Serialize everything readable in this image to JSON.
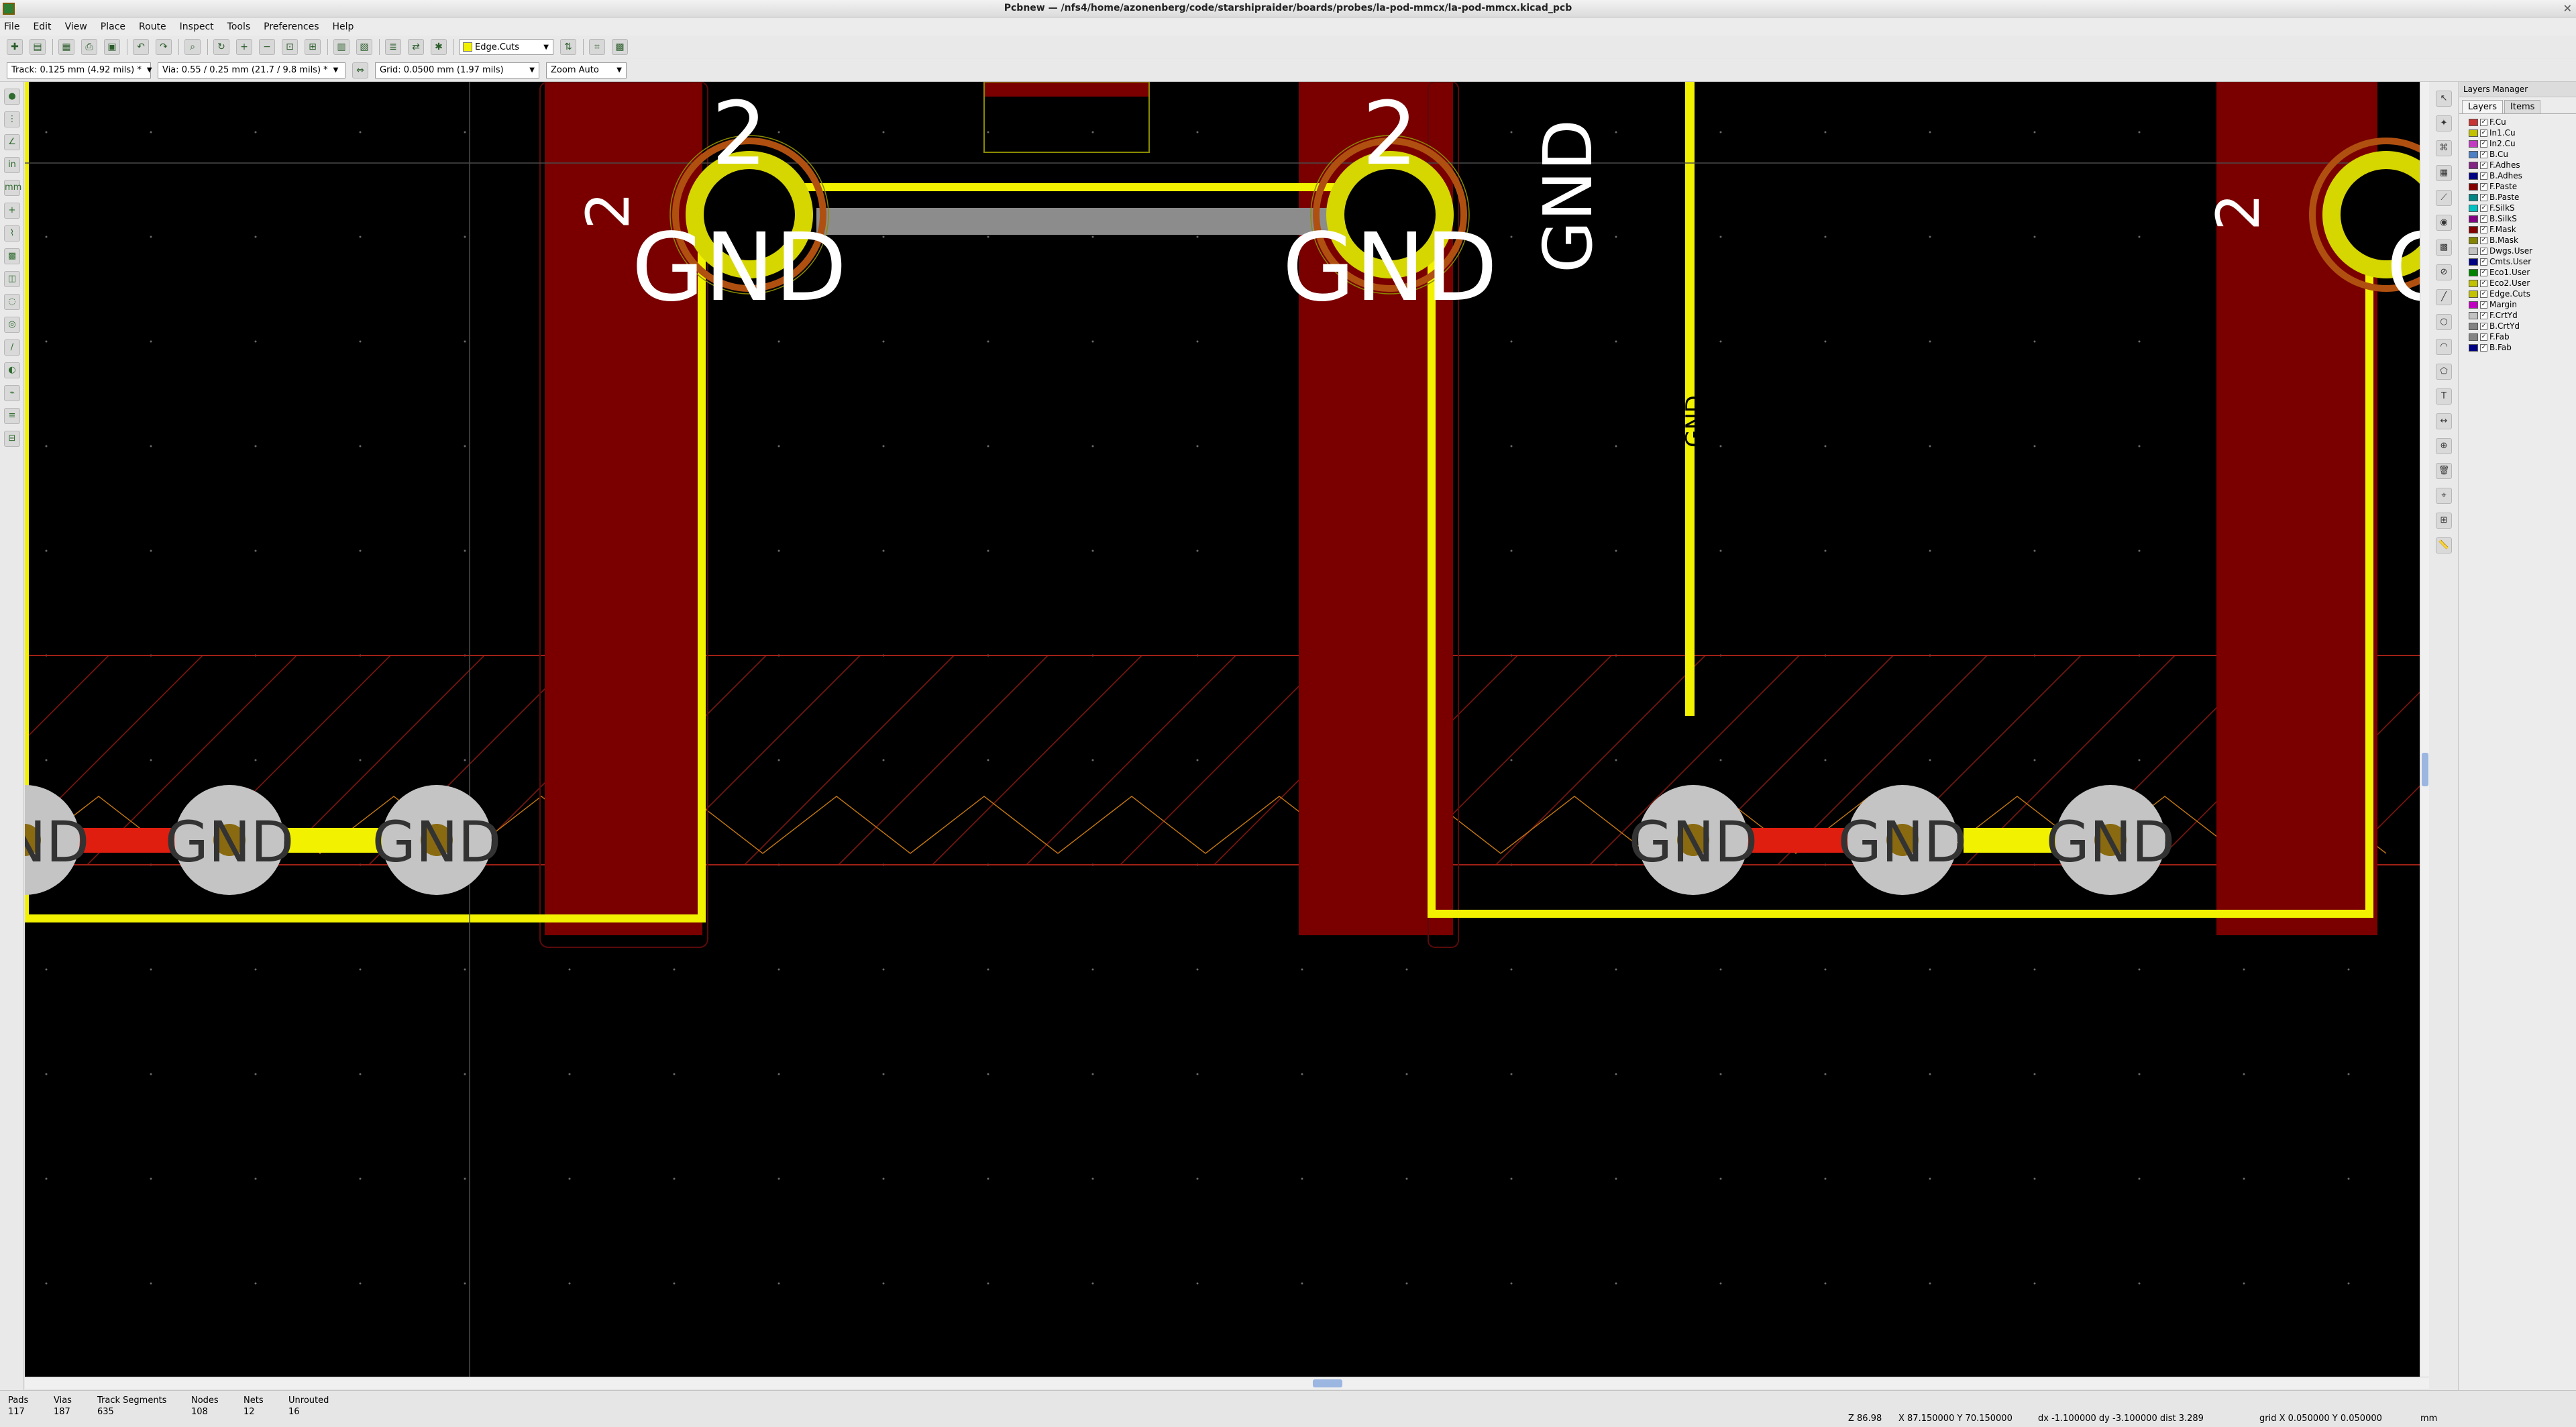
{
  "window": {
    "title": "Pcbnew — /nfs4/home/azonenberg/code/starshipraider/boards/probes/la-pod-mmcx/la-pod-mmcx.kicad_pcb"
  },
  "menu": [
    "File",
    "Edit",
    "View",
    "Place",
    "Route",
    "Inspect",
    "Tools",
    "Preferences",
    "Help"
  ],
  "toolbar": {
    "active_layer": "Edge.Cuts",
    "track": "Track: 0.125 mm (4.92 mils) *",
    "via": "Via: 0.55 / 0.25 mm (21.7 / 9.8 mils) *",
    "grid": "Grid: 0.0500 mm (1.97 mils)",
    "zoom": "Zoom Auto"
  },
  "layers_panel": {
    "title": "Layers Manager",
    "tabs": [
      "Layers",
      "Items"
    ],
    "layers": [
      {
        "name": "F.Cu",
        "color": "#c83434"
      },
      {
        "name": "In1.Cu",
        "color": "#c2c200"
      },
      {
        "name": "In2.Cu",
        "color": "#c23ac2"
      },
      {
        "name": "B.Cu",
        "color": "#4d7fc4"
      },
      {
        "name": "F.Adhes",
        "color": "#842484"
      },
      {
        "name": "B.Adhes",
        "color": "#000084"
      },
      {
        "name": "F.Paste",
        "color": "#840000"
      },
      {
        "name": "B.Paste",
        "color": "#008484"
      },
      {
        "name": "F.SilkS",
        "color": "#00c2c2"
      },
      {
        "name": "B.SilkS",
        "color": "#840084"
      },
      {
        "name": "F.Mask",
        "color": "#840000"
      },
      {
        "name": "B.Mask",
        "color": "#848400"
      },
      {
        "name": "Dwgs.User",
        "color": "#c2c2c2"
      },
      {
        "name": "Cmts.User",
        "color": "#000084"
      },
      {
        "name": "Eco1.User",
        "color": "#008400"
      },
      {
        "name": "Eco2.User",
        "color": "#c2c200"
      },
      {
        "name": "Edge.Cuts",
        "color": "#c2c200"
      },
      {
        "name": "Margin",
        "color": "#c200c2"
      },
      {
        "name": "F.CrtYd",
        "color": "#c2c2c2"
      },
      {
        "name": "B.CrtYd",
        "color": "#848484"
      },
      {
        "name": "F.Fab",
        "color": "#848484"
      },
      {
        "name": "B.Fab",
        "color": "#000084"
      }
    ]
  },
  "pcb": {
    "net_label": "GND",
    "pad_number": "2"
  },
  "status": {
    "pads_label": "Pads",
    "pads": "117",
    "vias_label": "Vias",
    "vias": "187",
    "tracks_label": "Track Segments",
    "tracks": "635",
    "nodes_label": "Nodes",
    "nodes": "108",
    "nets_label": "Nets",
    "nets": "12",
    "unrouted_label": "Unrouted",
    "unrouted": "16",
    "zoom": "Z 86.98",
    "xy": "X 87.150000  Y 70.150000",
    "delta": "dx -1.100000  dy -3.100000  dist 3.289",
    "grid": "grid X 0.050000  Y 0.050000",
    "units": "mm"
  }
}
